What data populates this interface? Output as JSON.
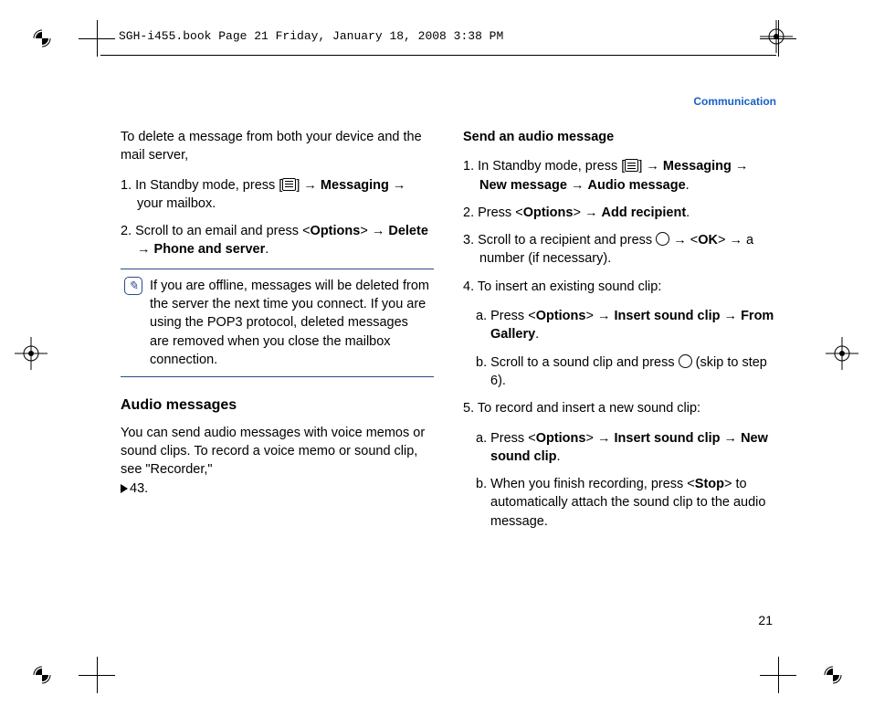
{
  "header": "SGH-i455.book  Page 21  Friday, January 18, 2008  3:38 PM",
  "section_label": "Communication",
  "page_number": "21",
  "left": {
    "intro": "To delete a message from both your device and the mail server,",
    "step1_a": "1. In Standby mode, press [",
    "step1_b": "] → ",
    "step1_c": "Messaging",
    "step1_d": " → your mailbox.",
    "step2_a": "2. Scroll to an email and press <",
    "step2_b": "Options",
    "step2_c": "> → ",
    "step2_d": "Delete",
    "step2_e": " → ",
    "step2_f": "Phone and server",
    "step2_g": ".",
    "note": "If you are offline, messages will be deleted from the server the next time you connect. If you are using the POP3 protocol, deleted messages are removed when you close the mailbox connection.",
    "h3": "Audio messages",
    "audiop_a": "You can send audio messages with voice memos or sound clips. To record a voice memo or sound clip, see \"Recorder,\" ",
    "audiop_b": "43."
  },
  "right": {
    "h4": "Send an audio message",
    "s1_a": "1. In Standby mode, press [",
    "s1_b": "] → ",
    "s1_c": "Messaging",
    "s1_d": " → ",
    "s1_e": "New message",
    "s1_f": " → ",
    "s1_g": "Audio message",
    "s1_h": ".",
    "s2_a": "2. Press <",
    "s2_b": "Options",
    "s2_c": "> → ",
    "s2_d": "Add recipient",
    "s2_e": ".",
    "s3_a": "3. Scroll to a recipient and press ",
    "s3_b": " → <",
    "s3_c": "OK",
    "s3_d": "> → a number (if necessary).",
    "s4": "4. To insert an existing sound clip:",
    "s4a_a": "a. Press <",
    "s4a_b": "Options",
    "s4a_c": "> → ",
    "s4a_d": "Insert sound clip",
    "s4a_e": " → ",
    "s4a_f": "From Gallery",
    "s4a_g": ".",
    "s4b_a": "b. Scroll to a sound clip and press ",
    "s4b_b": " (skip to step 6).",
    "s5": "5. To record and insert a new sound clip:",
    "s5a_a": "a. Press <",
    "s5a_b": "Options",
    "s5a_c": "> → ",
    "s5a_d": "Insert sound clip",
    "s5a_e": " → ",
    "s5a_f": "New sound clip",
    "s5a_g": ".",
    "s5b_a": "b. When you finish recording, press <",
    "s5b_b": "Stop",
    "s5b_c": "> to automatically attach the sound clip to the audio message."
  }
}
